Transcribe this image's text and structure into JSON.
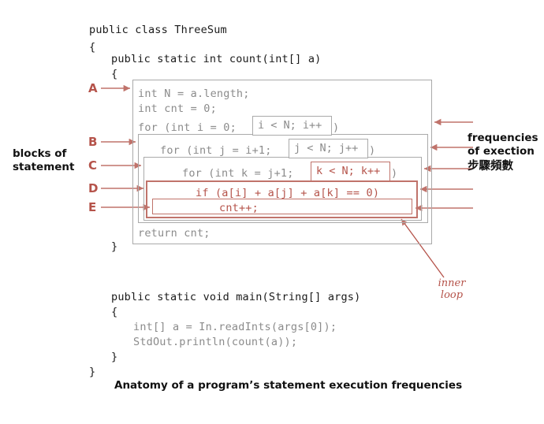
{
  "colors": {
    "red": "#b5534a",
    "red_border": "#c0736b",
    "gray_border": "#aaaaaa",
    "code_gray": "#8b8b8b",
    "code_dark": "#1a1a1a",
    "background": "#ffffff"
  },
  "code": {
    "class_decl": "public class ThreeSum",
    "class_open": "{",
    "method_decl": "public static int count(int[] a)",
    "method_open": "{",
    "line_N": "int N = a.length;",
    "line_cnt": "int cnt = 0;",
    "for_i_prefix": "for (int i = 0; ",
    "for_i_cond": "i < N; i++",
    "for_i_suffix": ")",
    "for_j_prefix": "for (int j = i+1; ",
    "for_j_cond": "j < N; j++",
    "for_j_suffix": ")",
    "for_k_prefix": "for (int k = j+1; ",
    "for_k_cond": "k < N; k++",
    "for_k_suffix": ")",
    "if_line": "if (a[i] + a[j] + a[k] == 0)",
    "cnt_line": "cnt++;",
    "return_line": "return cnt;",
    "method_close": "}",
    "main_decl": "public static void main(String[] args)",
    "main_open": "{",
    "main_line1": "int[] a = In.readInts(args[0]);",
    "main_line2": "StdOut.println(count(a));",
    "main_close": "}",
    "class_close": "}"
  },
  "labels": {
    "a": "A",
    "b": "B",
    "c": "C",
    "d": "D",
    "e": "E",
    "left_note": "blocks of\nstatement",
    "right_note_en": "frequencies\nof exection",
    "right_note_zh": "步驟頻數",
    "inner_loop": "inner\nloop"
  },
  "caption": {
    "text": "Anatomy of a program’s statement execution frequencies"
  }
}
